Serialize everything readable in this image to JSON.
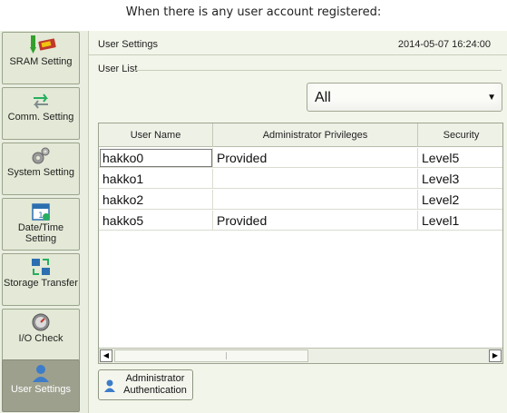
{
  "caption": "When there is any user account registered:",
  "sidebar": {
    "items": [
      {
        "label": "SRAM Setting",
        "icon": "sram-card-icon",
        "active": false
      },
      {
        "label": "Comm. Setting",
        "icon": "transfer-arrows-icon",
        "active": false
      },
      {
        "label": "System Setting",
        "icon": "gears-icon",
        "active": false
      },
      {
        "label": "Date/Time Setting",
        "icon": "calendar-icon",
        "active": false
      },
      {
        "label": "Storage Transfer",
        "icon": "storage-transfer-icon",
        "active": false
      },
      {
        "label": "I/O Check",
        "icon": "gauge-icon",
        "active": false
      },
      {
        "label": "User Settings",
        "icon": "user-icon",
        "active": true
      }
    ]
  },
  "header": {
    "title": "User Settings",
    "datetime": "2014-05-07  16:24:00"
  },
  "user_list": {
    "group_label": "User List",
    "filter": {
      "selected": "All"
    },
    "columns": [
      "User Name",
      "Administrator Privileges",
      "Security"
    ],
    "rows": [
      {
        "user": "hakko0",
        "admin": "Provided",
        "security": "Level5"
      },
      {
        "user": "hakko1",
        "admin": "",
        "security": "Level3"
      },
      {
        "user": "hakko2",
        "admin": "",
        "security": "Level2"
      },
      {
        "user": "hakko5",
        "admin": "Provided",
        "security": "Level1"
      }
    ]
  },
  "admin_button": {
    "label_line1": "Administrator",
    "label_line2": "Authentication"
  },
  "colors": {
    "panel_bg": "#f2f5ea",
    "sidebar_bg": "#e3e9d6",
    "active_item": "#9ea08e"
  }
}
